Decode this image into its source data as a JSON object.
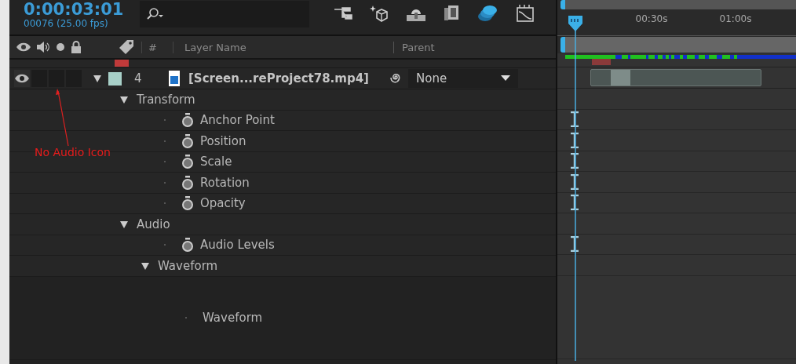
{
  "timecode": "0:00:03:01",
  "frame_info": "00076 (25.00 fps)",
  "columns": {
    "number": "#",
    "layer_name": "Layer Name",
    "parent": "Parent"
  },
  "layer": {
    "visible": true,
    "expanded": true,
    "color": "#a8d0c8",
    "number": "4",
    "name": "[Screen...reProject78.mp4]",
    "parent": "None"
  },
  "properties": [
    {
      "label": "Transform",
      "kind": "group",
      "expanded": true,
      "children": [
        {
          "label": "Anchor Point",
          "kind": "property"
        },
        {
          "label": "Position",
          "kind": "property"
        },
        {
          "label": "Scale",
          "kind": "property"
        },
        {
          "label": "Rotation",
          "kind": "property"
        },
        {
          "label": "Opacity",
          "kind": "property"
        }
      ]
    },
    {
      "label": "Audio",
      "kind": "group",
      "expanded": true,
      "children": [
        {
          "label": "Audio Levels",
          "kind": "property"
        },
        {
          "label": "Waveform",
          "kind": "group",
          "expanded": true,
          "children": [
            {
              "label": "Waveform",
              "kind": "waveform"
            }
          ]
        }
      ]
    }
  ],
  "annotation": "No Audio Icon",
  "ruler": {
    "labels": [
      "00:30s",
      "01:00s"
    ]
  }
}
